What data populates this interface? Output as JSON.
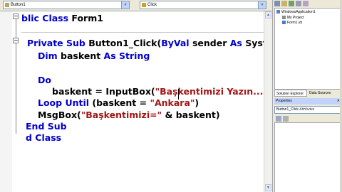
{
  "editor": {
    "class_combo": "Button1",
    "method_combo": "Click",
    "code_lines": [
      [
        {
          "t": "blic Class ",
          "c": "kw"
        },
        {
          "t": "Form1",
          "c": "plain"
        }
      ],
      [
        {
          "t": "Private Sub ",
          "c": "kw"
        },
        {
          "t": "Button1_Click(",
          "c": "plain"
        },
        {
          "t": "ByVal",
          "c": "kw"
        },
        {
          "t": " sender ",
          "c": "plain"
        },
        {
          "t": "As",
          "c": "kw"
        },
        {
          "t": " System.Ob",
          "c": "plain"
        }
      ],
      [
        {
          "t": "Dim",
          "c": "kw"
        },
        {
          "t": " baskent ",
          "c": "plain"
        },
        {
          "t": "As String",
          "c": "kw"
        }
      ],
      [
        {
          "t": "Do",
          "c": "kw"
        }
      ],
      [
        {
          "t": "baskent = InputBox(",
          "c": "plain"
        },
        {
          "t": "\"Başkentimizi Yazın...\"",
          "c": "str"
        },
        {
          "t": ")",
          "c": "plain"
        }
      ],
      [
        {
          "t": "Loop Until",
          "c": "kw"
        },
        {
          "t": " (baskent = ",
          "c": "plain"
        },
        {
          "t": "\"Ankara\"",
          "c": "str"
        },
        {
          "t": ")",
          "c": "plain"
        }
      ],
      [
        {
          "t": "MsgBox(",
          "c": "plain"
        },
        {
          "t": "\"Başkentimizi=\"",
          "c": "str"
        },
        {
          "t": " & baskent)",
          "c": "plain"
        }
      ],
      [
        {
          "t": "End Sub",
          "c": "kw"
        }
      ],
      [
        {
          "t": "d Class",
          "c": "kw"
        }
      ]
    ]
  },
  "solution_explorer": {
    "project": "WindowsApplication1",
    "items": [
      "My Project",
      "Form1.vb"
    ],
    "tabs": [
      "Solution Explorer",
      "Data Sources"
    ]
  },
  "properties": {
    "title": "Properties",
    "object": "Button1_Click",
    "object_type": "Attributes"
  }
}
